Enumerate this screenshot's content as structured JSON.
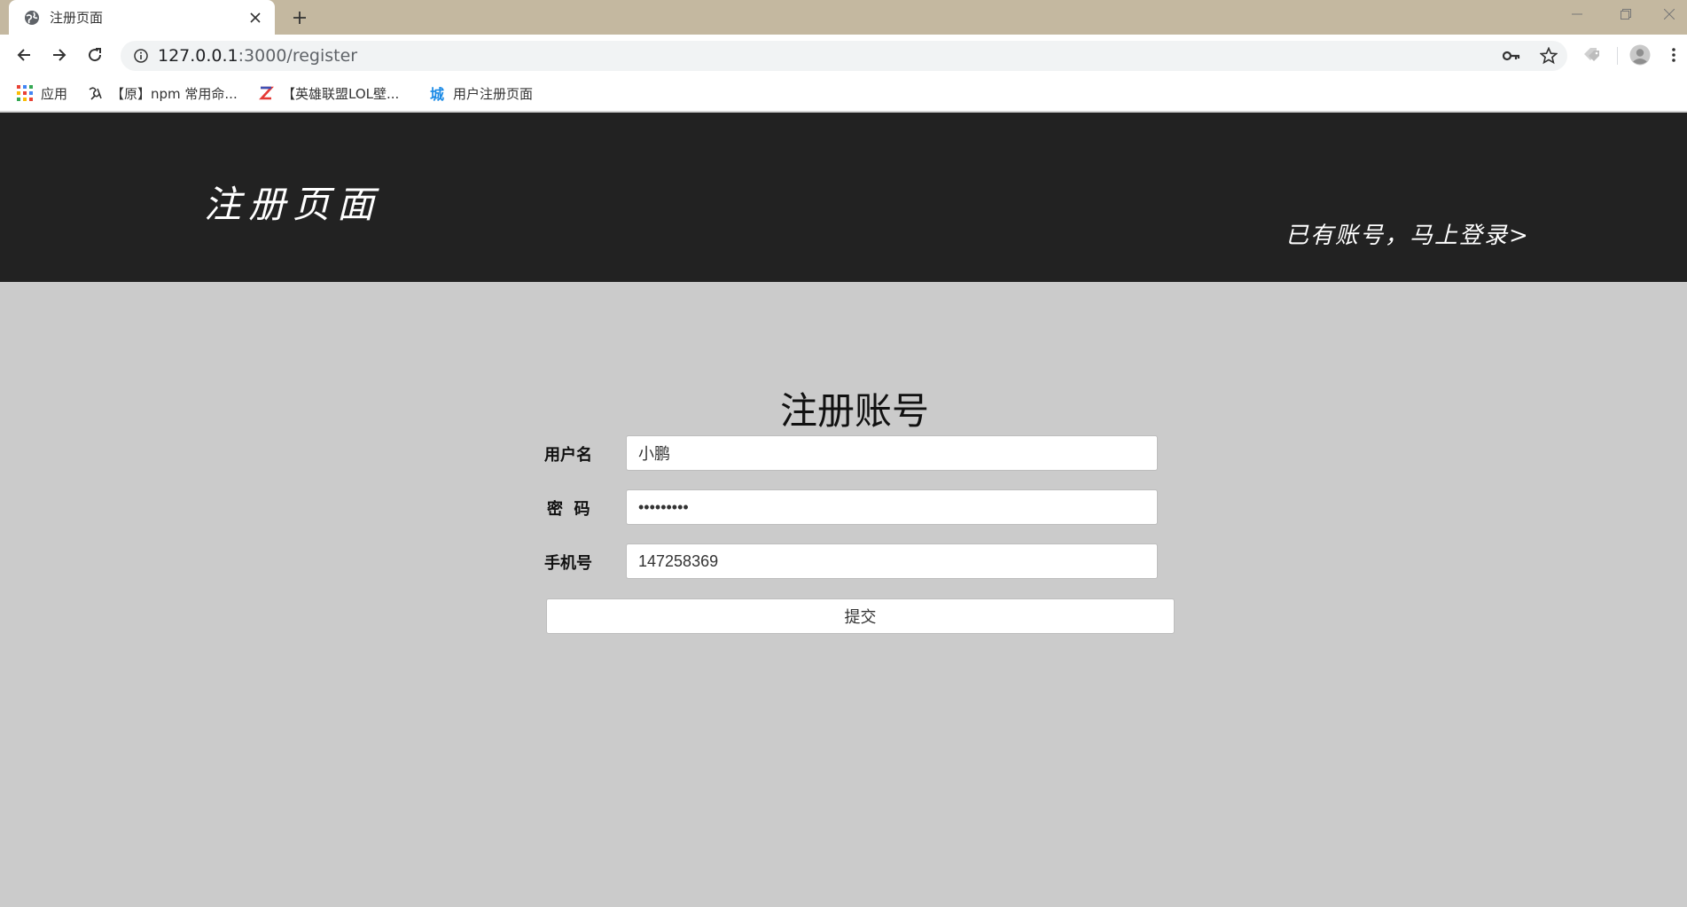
{
  "browser": {
    "tab": {
      "title": "注册页面",
      "favicon": "globe-icon"
    },
    "url": {
      "host": "127.0.0.1",
      "rest": ":3000/register"
    },
    "bookmarks": [
      {
        "label": "应用",
        "icon": "apps-grid-icon"
      },
      {
        "label": "【原】npm 常用命...",
        "icon": "hand-drawn-icon"
      },
      {
        "label": "【英雄联盟LOL壁...",
        "icon": "z-logo-icon"
      },
      {
        "label": "用户注册页面",
        "icon": "城",
        "icon_color": "#1a8ae6"
      }
    ]
  },
  "header": {
    "title": "注册页面",
    "login_link": "已有账号，马上登录>",
    "background": "#222222"
  },
  "form": {
    "heading": "注册账号",
    "fields": [
      {
        "label": "用户名",
        "value": "小鹏",
        "type": "text"
      },
      {
        "label": "密  码",
        "value": "•••••••••",
        "type": "password"
      },
      {
        "label": "手机号",
        "value": "147258369",
        "type": "text"
      }
    ],
    "submit_label": "提交"
  },
  "page_background": "#cbcbcb"
}
